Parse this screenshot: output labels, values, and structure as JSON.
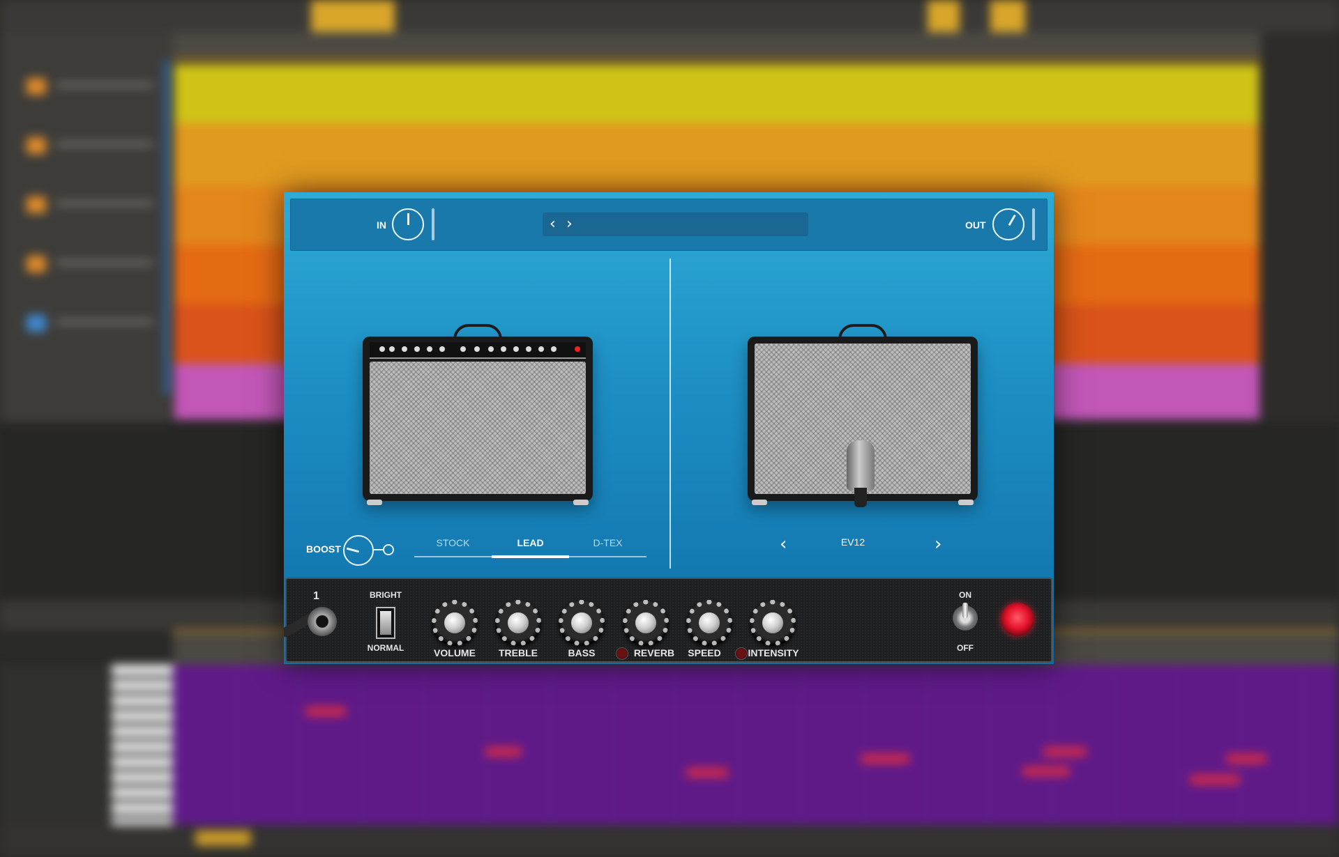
{
  "plugin": {
    "header": {
      "in_label": "IN",
      "out_label": "OUT",
      "preset_prev_icon": "chevron-left-icon",
      "preset_next_icon": "chevron-right-icon",
      "preset_name": ""
    },
    "amp": {
      "boost_label": "BOOST",
      "modes": [
        {
          "label": "STOCK",
          "active": false
        },
        {
          "label": "LEAD",
          "active": true
        },
        {
          "label": "D-TEX",
          "active": false
        }
      ]
    },
    "cabinet": {
      "prev_icon": "chevron-left-icon",
      "next_icon": "chevron-right-icon",
      "name": "EV12"
    },
    "controls": {
      "input_number": "1",
      "bright_label": "BRIGHT",
      "normal_label": "NORMAL",
      "knobs": [
        {
          "label": "VOLUME"
        },
        {
          "label": "TREBLE"
        },
        {
          "label": "BASS"
        },
        {
          "label": "REVERB"
        },
        {
          "label": "SPEED"
        },
        {
          "label": "INTENSITY"
        }
      ],
      "on_label": "ON",
      "off_label": "OFF"
    },
    "colors": {
      "accent": "#1d8fc4",
      "header": "#1879aa",
      "panel": "#1e1f21",
      "power_led": "#e5122a"
    }
  }
}
